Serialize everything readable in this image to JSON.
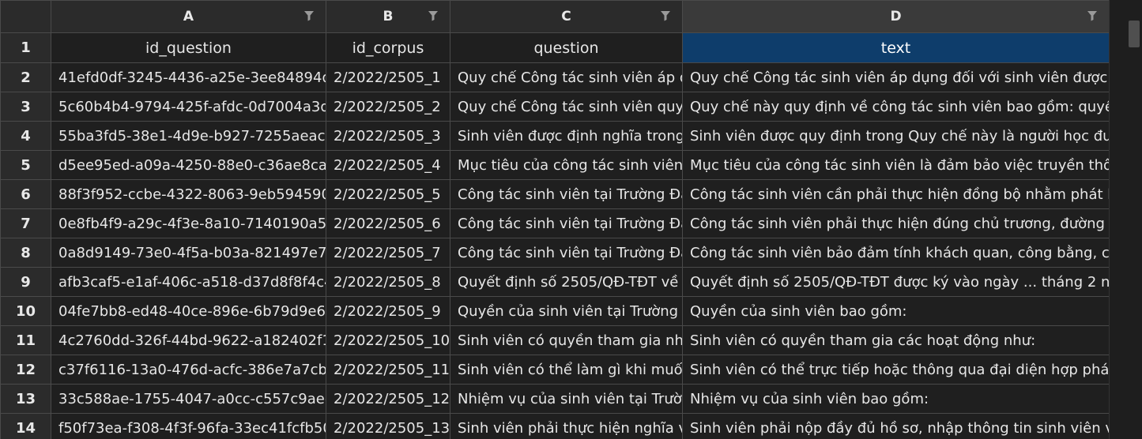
{
  "columns": {
    "A": {
      "letter": "A"
    },
    "B": {
      "letter": "B"
    },
    "C": {
      "letter": "C"
    },
    "D": {
      "letter": "D"
    }
  },
  "header_row": {
    "number": "1",
    "A": "id_question",
    "B": "id_corpus",
    "C": "question",
    "D": "text"
  },
  "rows": [
    {
      "n": "2",
      "A": "41efd0df-3245-4436-a25e-3ee84894d9",
      "B": "2/2022/2505_1",
      "C": "Quy chế Công tác sinh viên áp dụ",
      "D": "Quy chế Công tác sinh viên áp dụng đối với sinh viên được địn"
    },
    {
      "n": "3",
      "A": "5c60b4b4-9794-425f-afdc-0d7004a3d3",
      "B": "2/2022/2505_2",
      "C": "Quy chế Công tác sinh viên quy đ",
      "D": "Quy chế này quy định về công tác sinh viên bao gồm: quyền v"
    },
    {
      "n": "4",
      "A": "55ba3fd5-38e1-4d9e-b927-7255aeac91",
      "B": "2/2022/2505_3",
      "C": "Sinh viên được định nghĩa trong ",
      "D": "Sinh viên được quy định trong Quy chế này là người học được"
    },
    {
      "n": "5",
      "A": "d5ee95ed-a09a-4250-88e0-c36ae8ca35",
      "B": "2/2022/2505_4",
      "C": "Mục tiêu của công tác sinh viên t",
      "D": "Mục tiêu của công tác sinh viên là đảm bảo việc truyền thông"
    },
    {
      "n": "6",
      "A": "88f3f952-ccbe-4322-8063-9eb5945907",
      "B": "2/2022/2505_5",
      "C": "Công tác sinh viên tại Trường Đại",
      "D": "Công tác sinh viên cần phải thực hiện đồng bộ nhằm phát huy"
    },
    {
      "n": "7",
      "A": "0e8fb4f9-a29c-4f3e-8a10-7140190a55f",
      "B": "2/2022/2505_6",
      "C": "Công tác sinh viên tại Trường Đại",
      "D": "Công tác sinh viên phải thực hiện đúng chủ trương, đường lối"
    },
    {
      "n": "8",
      "A": "0a8d9149-73e0-4f5a-b03a-821497e771",
      "B": "2/2022/2505_7",
      "C": "Công tác sinh viên tại Trường Đại",
      "D": "Công tác sinh viên bảo đảm tính khách quan, công bằng, công"
    },
    {
      "n": "9",
      "A": "afb3caf5-e1af-406c-a518-d37d8f8f4c4",
      "B": "2/2022/2505_8",
      "C": "Quyết định số 2505/QĐ-TĐT về v",
      "D": "Quyết định số 2505/QĐ-TĐT được ký vào ngày ... tháng 2 năm"
    },
    {
      "n": "10",
      "A": "04fe7bb8-ed48-40ce-896e-6b79d9e617",
      "B": "2/2022/2505_9",
      "C": "Quyền của sinh viên tại Trường Đ",
      "D": "Quyền của sinh viên bao gồm:"
    },
    {
      "n": "11",
      "A": "4c2760dd-326f-44bd-9622-a182402f17",
      "B": "2/2022/2505_10",
      "C": "Sinh viên có quyền tham gia nhữ",
      "D": "Sinh viên có quyền tham gia các hoạt động như:"
    },
    {
      "n": "12",
      "A": "c37f6116-13a0-476d-acfc-386e7a7cb0e",
      "B": "2/2022/2505_11",
      "C": "Sinh viên có thể làm gì khi muốn",
      "D": "Sinh viên có thể trực tiếp hoặc thông qua đại diện hợp pháp c"
    },
    {
      "n": "13",
      "A": "33c588ae-1755-4047-a0cc-c557c9aee8",
      "B": "2/2022/2505_12",
      "C": "Nhiệm vụ của sinh viên tại Trường",
      "D": "Nhiệm vụ của sinh viên bao gồm:"
    },
    {
      "n": "14",
      "A": "f50f73ea-f308-4f3f-96fa-33ec41fcfb50",
      "B": "2/2022/2505_13",
      "C": "Sinh viên phải thực hiện nghĩa vụ",
      "D": "Sinh viên phải nộp đầy đủ hồ sơ, nhập thông tin sinh viên và"
    }
  ],
  "icons": {
    "filter": "filter-funnel-icon"
  },
  "colors": {
    "selected_header": "#0e3d6b",
    "grid": "#4a4a4a",
    "background": "#1f1f1f"
  }
}
